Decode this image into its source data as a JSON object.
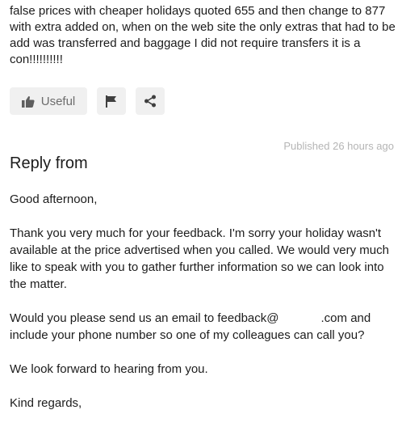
{
  "review": {
    "body": "false prices with cheaper holidays quoted 655 and then change to 877 with extra added on, when on the web site the only extras that had to be add was transferred and baggage I did not require transfers it is a con!!!!!!!!!!"
  },
  "actions": {
    "useful_label": "Useful",
    "icons": [
      "thumbs-up-icon",
      "flag-icon",
      "share-icon"
    ]
  },
  "reply": {
    "published": "Published 26 hours ago",
    "title": "Reply from",
    "greeting": "Good afternoon,",
    "paragraph1": "Thank you very much for your feedback. I'm sorry your holiday wasn't available at the price advertised when you called. We would very much like to speak with you to gather further information so we can look into the matter.",
    "paragraph2_start": "Would you please send us an email to feedback@",
    "paragraph2_domain": ".com",
    "paragraph2_end": "and include your phone number so one of my colleagues can call you?",
    "paragraph3": "We look forward to hearing from you.",
    "signoff": "Kind regards,"
  },
  "colors": {
    "text": "#1c1c1c",
    "muted": "#6c6c6c",
    "button_bg": "#f0f0f0",
    "timestamp": "#b5b5b5"
  }
}
